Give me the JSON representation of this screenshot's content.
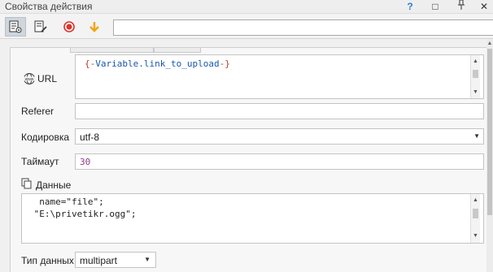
{
  "window": {
    "title": "Свойства действия",
    "buttons": [
      "?",
      "□",
      "⊥",
      "✕"
    ]
  },
  "form": {
    "url_label": "URL",
    "url_value_prefix": "{-",
    "url_value_var": "Variable.link_to_upload",
    "url_value_suffix": "-}",
    "referer_label": "Referer",
    "referer_value": "",
    "encoding_label": "Кодировка",
    "encoding_value": "utf-8",
    "timeout_label": "Таймаут",
    "timeout_value": "30",
    "data_label": "Данные",
    "data_line1": "  name=\"file\";",
    "data_line2": " \"E:\\privetikr.ogg\";",
    "data_type_label": "Тип данных",
    "data_type_value": "multipart"
  },
  "colors": {
    "record": "#e0312a",
    "arrow": "#f2a30f",
    "variable": "#1a56b0",
    "brace": "#c0392b",
    "timeout": "#8b3a8f"
  }
}
